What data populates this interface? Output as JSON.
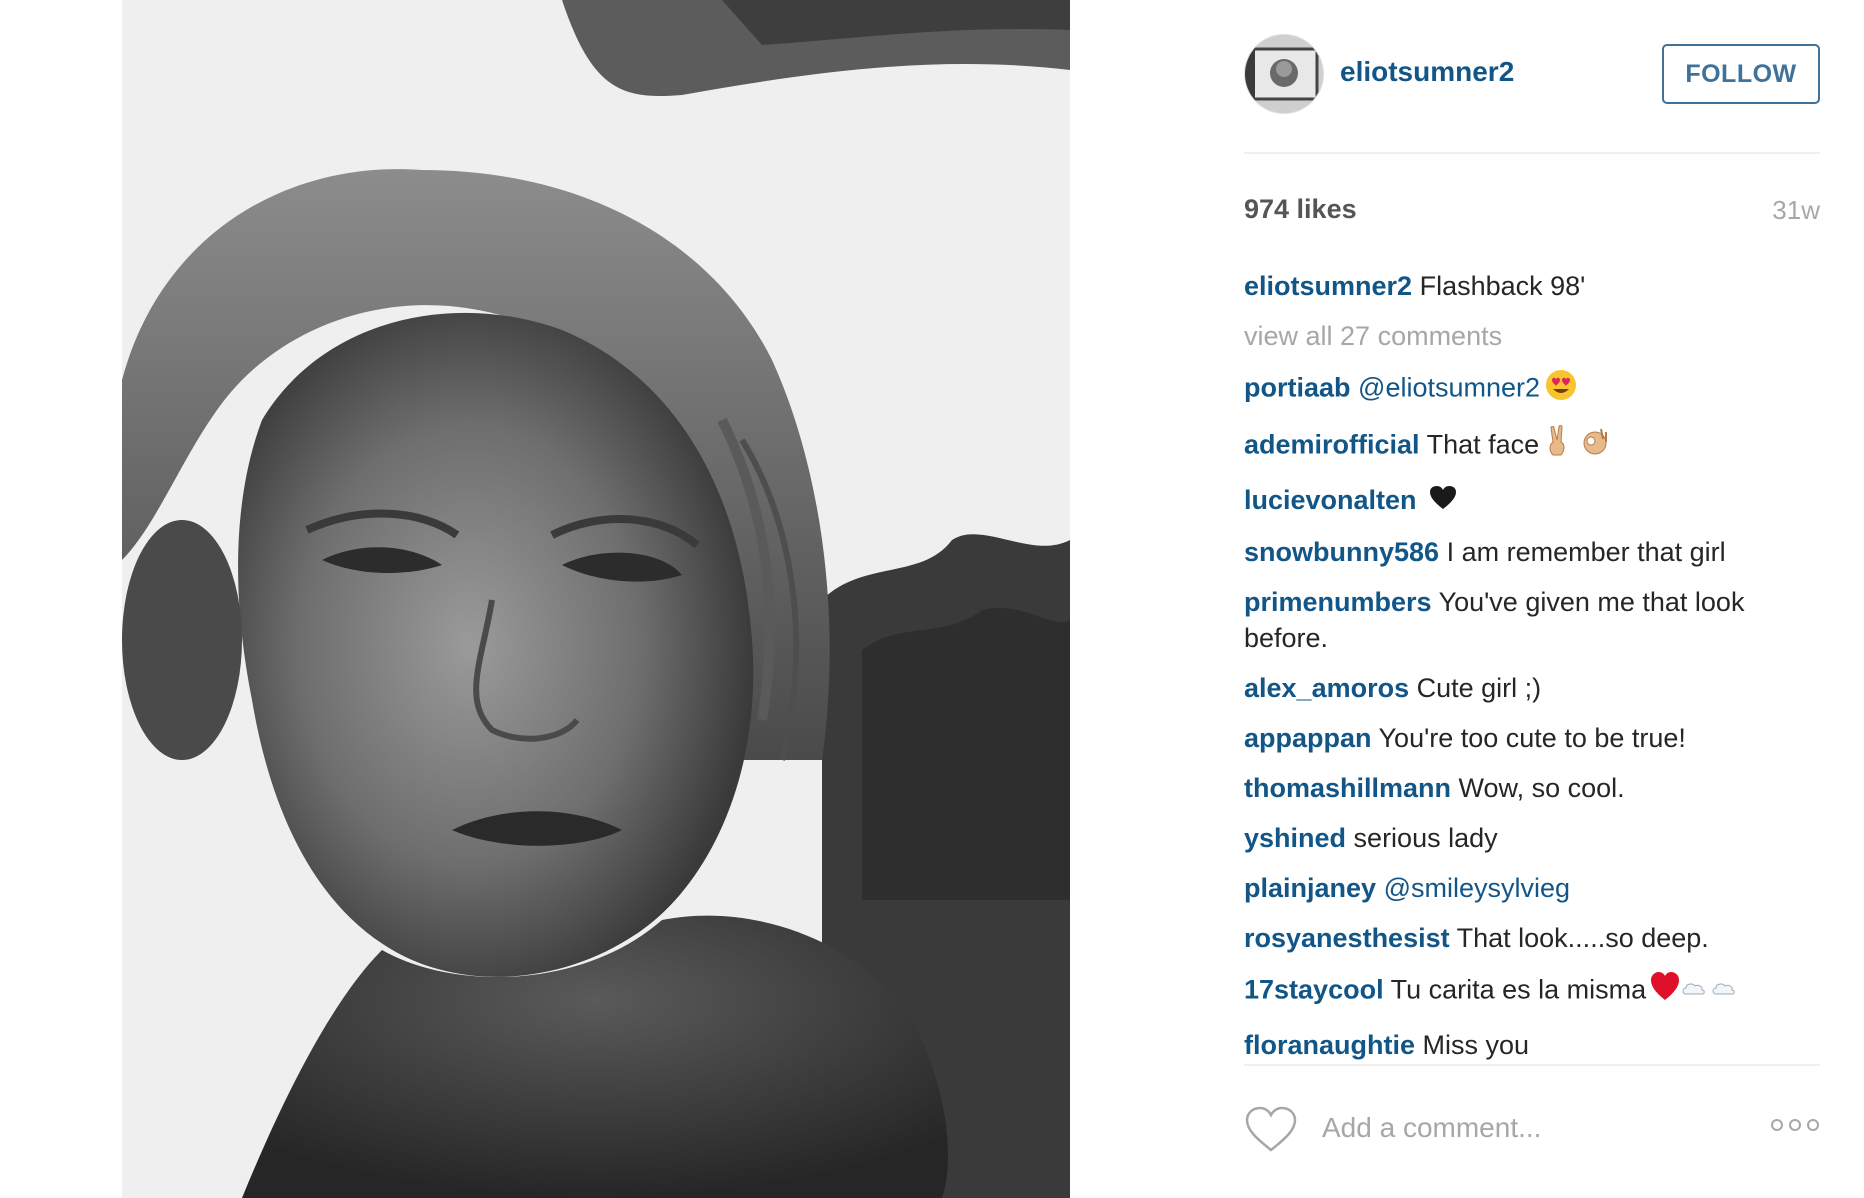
{
  "post": {
    "username": "eliotsumner2",
    "follow_label": "FOLLOW",
    "likes": "974 likes",
    "time": "31w",
    "caption_user": "eliotsumner2",
    "caption_text": "Flashback 98'",
    "view_all": "view all 27 comments",
    "add_comment_placeholder": "Add a comment...",
    "heart_icon": "heart-outline-icon",
    "more_icon": "more-options-icon"
  },
  "comments": [
    {
      "user": "portiaab",
      "mention": "@eliotsumner2",
      "text": "",
      "emoji": "heart-eyes"
    },
    {
      "user": "ademirofficial",
      "mention": "",
      "text": "That face",
      "emoji": "victory-ok"
    },
    {
      "user": "lucievonalten",
      "mention": "",
      "text": "",
      "emoji": "black-heart"
    },
    {
      "user": "snowbunny586",
      "mention": "",
      "text": "I am remember that girl",
      "emoji": ""
    },
    {
      "user": "primenumbers",
      "mention": "",
      "text": "You've given me that look before.",
      "emoji": ""
    },
    {
      "user": "alex_amoros",
      "mention": "",
      "text": "Cute girl ;)",
      "emoji": ""
    },
    {
      "user": "appappan",
      "mention": "",
      "text": "You're too cute to be true!",
      "emoji": ""
    },
    {
      "user": "thomashillmann",
      "mention": "",
      "text": "Wow, so cool.",
      "emoji": ""
    },
    {
      "user": "yshined",
      "mention": "",
      "text": "serious lady",
      "emoji": ""
    },
    {
      "user": "plainjaney",
      "mention": "@smileysylvieg",
      "text": "",
      "emoji": ""
    },
    {
      "user": "rosyanesthesist",
      "mention": "",
      "text": "That look.....so deep.",
      "emoji": ""
    },
    {
      "user": "17staycool",
      "mention": "",
      "text": "Tu carita es la misma",
      "emoji": "red-heart-clouds"
    },
    {
      "user": "floranaughtie",
      "mention": "",
      "text": "Miss you",
      "emoji": ""
    }
  ],
  "colors": {
    "link": "#125688",
    "follow": "#3f729b",
    "muted": "#a5a7aa",
    "text": "#262626"
  }
}
